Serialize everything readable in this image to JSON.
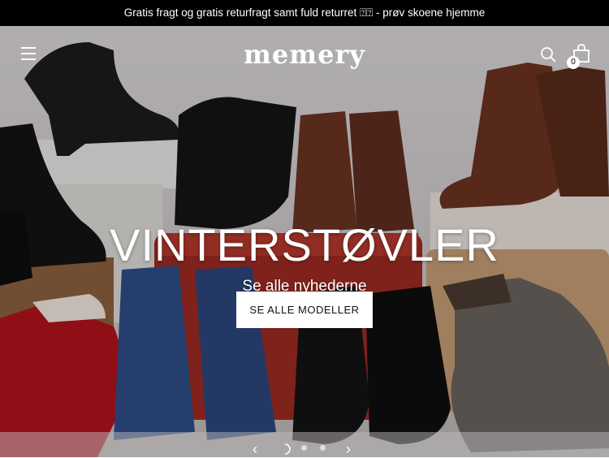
{
  "announcement": {
    "text": "Gratis fragt og gratis returfragt samt fuld returret ⍰⍰ - prøv skoene hjemme"
  },
  "header": {
    "logo": "memery",
    "cart_count": "0"
  },
  "hero": {
    "title": "VINTERSTØVLER",
    "subtitle": "Se alle nyhederne",
    "cta_label": "SE ALLE MODELLER",
    "prev_label": "‹",
    "next_label": "›",
    "slide_count": 3,
    "active_slide": 1
  },
  "icons": [
    "menu-icon",
    "search-icon",
    "cart-icon",
    "chevron-left-icon",
    "chevron-right-icon"
  ],
  "colors": {
    "announcement_bg": "#000000",
    "text_light": "#ffffff",
    "button_bg": "#ffffff"
  }
}
